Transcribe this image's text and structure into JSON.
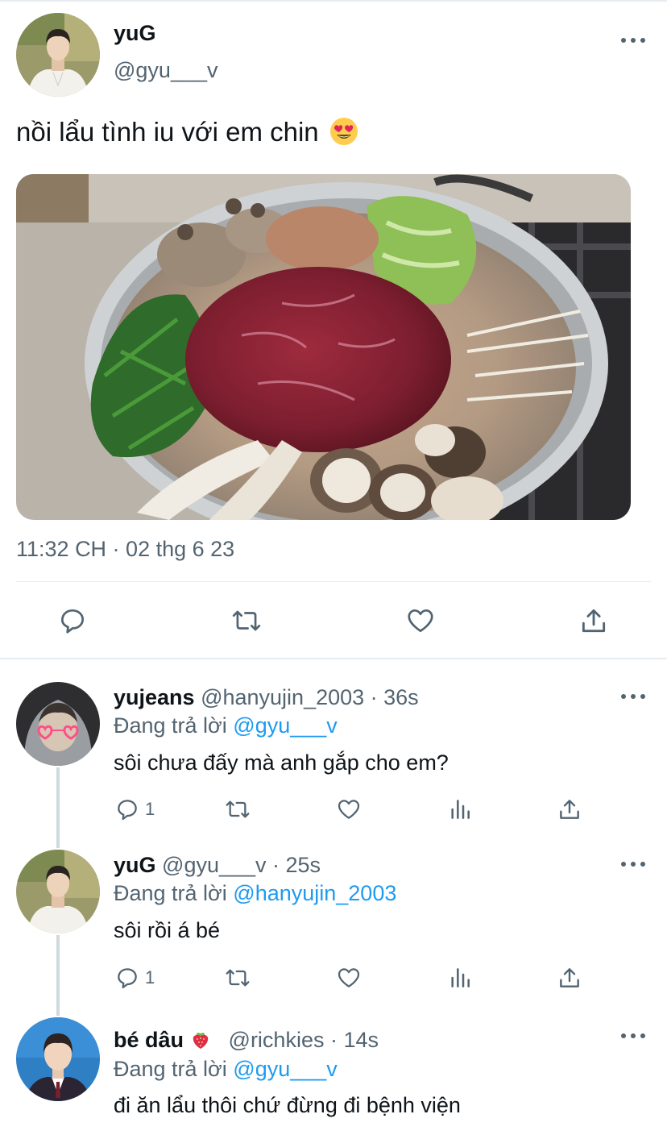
{
  "main_tweet": {
    "name": "yuG",
    "handle": "@gyu___v",
    "text": "nồi lẩu tình iu với em chin",
    "emoji": "heart-eyes-emoji",
    "timestamp": "11:32 CH · 02 thg 6 23",
    "actions": [
      "reply-icon",
      "retweet-icon",
      "like-icon",
      "share-icon"
    ]
  },
  "replies": [
    {
      "name": "yujeans",
      "meta": "@hanyujin_2003 · 36s",
      "replying_prefix": "Đang trả lời",
      "replying_to": "@gyu___v",
      "text": "sôi chưa đấy mà anh gắp cho em?",
      "reply_count": "1"
    },
    {
      "name": "yuG",
      "meta": "@gyu___v · 25s",
      "replying_prefix": "Đang trả lời",
      "replying_to": "@hanyujin_2003",
      "text": "sôi rồi á bé",
      "reply_count": "1"
    },
    {
      "name": "bé dâu",
      "name_emoji": "strawberry-emoji",
      "meta": "@richkies · 14s",
      "replying_prefix": "Đang trả lời",
      "replying_to": "@gyu___v",
      "text": "đi ăn lẩu thôi chứ đừng đi bệnh viện"
    }
  ],
  "colors": {
    "text": "#0f1419",
    "secondary": "#536471",
    "link": "#1d9bf0",
    "divider": "#e6ecf0"
  }
}
